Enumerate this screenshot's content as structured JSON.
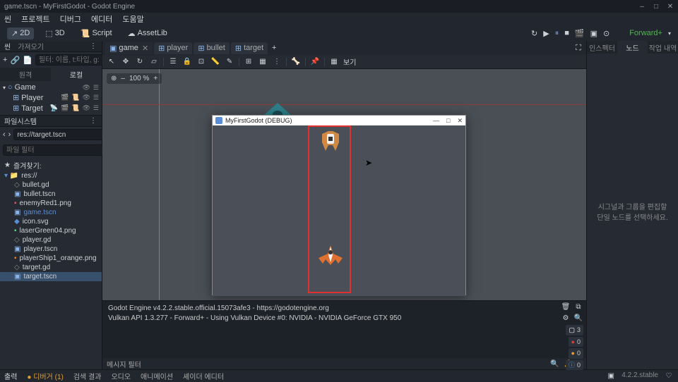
{
  "titlebar": {
    "title": "game.tscn - MyFirstGodot - Godot Engine"
  },
  "menubar": [
    "씬",
    "프로젝트",
    "디버그",
    "에디터",
    "도움말"
  ],
  "workspace_tabs": [
    {
      "label": "2D",
      "icon": "2d",
      "active": true
    },
    {
      "label": "3D",
      "icon": "3d"
    },
    {
      "label": "Script",
      "icon": "script"
    },
    {
      "label": "AssetLib",
      "icon": "asset"
    }
  ],
  "renderer": "Forward+",
  "scene_panel": {
    "tab_label": "가져오기",
    "filter_placeholder": "필터: 이름, t:타입, g:",
    "subtabs": {
      "left": "원격",
      "right": "로컬"
    },
    "nodes": [
      {
        "name": "Game",
        "icon": "node2d",
        "indent": 0,
        "expand": true
      },
      {
        "name": "Player",
        "icon": "node2d",
        "indent": 1,
        "scripts": true
      },
      {
        "name": "Target",
        "icon": "node2d",
        "indent": 1,
        "scripts": true
      }
    ]
  },
  "filesystem": {
    "title": "파일시스템",
    "path": "res://target.tscn",
    "filter_placeholder": "파일 필터",
    "fav_label": "즐겨찾기:",
    "root": "res://",
    "files": [
      {
        "name": "bullet.gd",
        "type": "gd"
      },
      {
        "name": "bullet.tscn",
        "type": "scene"
      },
      {
        "name": "enemyRed1.png",
        "type": "img"
      },
      {
        "name": "game.tscn",
        "type": "scene",
        "hl": true
      },
      {
        "name": "icon.svg",
        "type": "img"
      },
      {
        "name": "laserGreen04.png",
        "type": "img"
      },
      {
        "name": "player.gd",
        "type": "gd"
      },
      {
        "name": "player.tscn",
        "type": "scene"
      },
      {
        "name": "playerShip1_orange.png",
        "type": "img"
      },
      {
        "name": "target.gd",
        "type": "gd"
      },
      {
        "name": "target.tscn",
        "type": "scene",
        "sel": true
      }
    ]
  },
  "scene_tabs": [
    {
      "label": "game",
      "active": true,
      "close": true
    },
    {
      "label": "player"
    },
    {
      "label": "bullet"
    },
    {
      "label": "target"
    }
  ],
  "viewport_toolbar": {
    "view_label": "보기"
  },
  "zoom": "100 %",
  "game_window": {
    "title": "MyFirstGodot (DEBUG)"
  },
  "output": {
    "line1": "Godot Engine v4.2.2.stable.official.15073afe3 - https://godotengine.org",
    "line2": "Vulkan API 1.3.277 - Forward+ - Using Vulkan Device #0: NVIDIA - NVIDIA GeForce GTX 950",
    "msg_filter": "메시지 필터",
    "chips": [
      {
        "dot": "#ffffff",
        "n": "3"
      },
      {
        "dot": "#d04040",
        "n": "0"
      },
      {
        "dot": "#e0a030",
        "n": "0"
      },
      {
        "dot": "#3aa0e0",
        "n": "0"
      }
    ]
  },
  "bottom_tabs": {
    "items": [
      "출력",
      "디버거 (1)",
      "검색 결과",
      "오디오",
      "애니메이션",
      "셰이더 에디터"
    ],
    "version": "4.2.2.stable"
  },
  "inspector": {
    "tabs": [
      "인스펙터",
      "노드",
      "작업 내역"
    ],
    "active": 1,
    "message": "시그널과 그룹을 편집할 단일 노드를 선택하세요."
  }
}
